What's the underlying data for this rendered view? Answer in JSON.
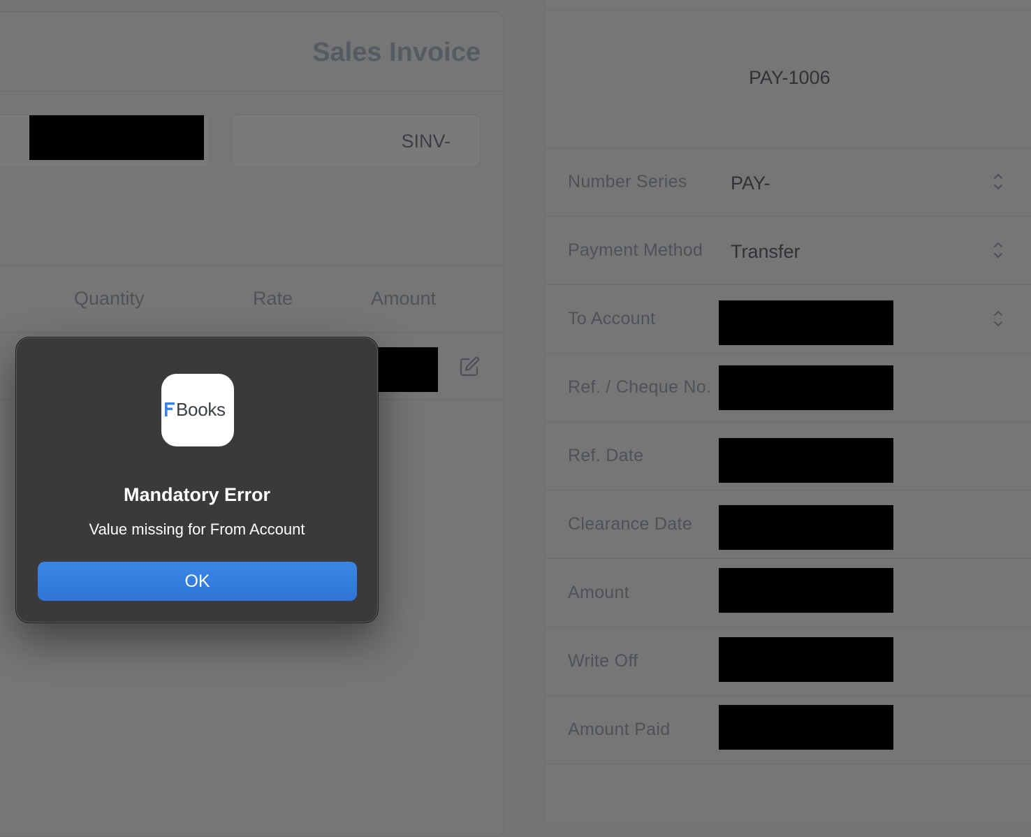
{
  "invoice": {
    "title": "Sales Invoice",
    "number_series_value": "SINV-",
    "columns": [
      "Quantity",
      "Rate",
      "Amount"
    ]
  },
  "payment": {
    "name": "PAY-1006",
    "fields": [
      {
        "label": "Number Series",
        "value": "PAY-"
      },
      {
        "label": "Payment Method",
        "value": "Transfer"
      },
      {
        "label": "To Account",
        "value": ""
      },
      {
        "label": "Ref. / Cheque No.",
        "value": ""
      },
      {
        "label": "Ref. Date",
        "value": ""
      },
      {
        "label": "Clearance Date",
        "value": ""
      },
      {
        "label": "Amount",
        "value": ""
      },
      {
        "label": "Write Off",
        "value": ""
      },
      {
        "label": "Amount Paid",
        "value": ""
      }
    ]
  },
  "dialog": {
    "app_name": "Books",
    "title": "Mandatory Error",
    "message": "Value missing for From Account",
    "ok_label": "OK"
  },
  "colors": {
    "overlay_background": "#747474",
    "dialog_background": "#3a3a3a",
    "ok_button": "#3380e0",
    "app_icon_accent": "#3c82e6"
  },
  "icons": [
    "edit-icon",
    "chevron-updown-icon",
    "frappe-books-logo"
  ]
}
